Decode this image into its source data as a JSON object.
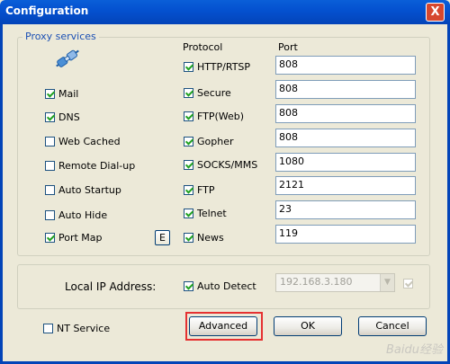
{
  "window": {
    "title": "Configuration",
    "close_label": "X"
  },
  "proxy": {
    "group_label": "Proxy services",
    "protocol_header": "Protocol",
    "port_header": "Port",
    "services": [
      {
        "label": "Mail",
        "checked": true
      },
      {
        "label": "DNS",
        "checked": true
      },
      {
        "label": "Web Cached",
        "checked": false
      },
      {
        "label": "Remote Dial-up",
        "checked": false
      },
      {
        "label": "Auto Startup",
        "checked": false
      },
      {
        "label": "Auto Hide",
        "checked": false
      },
      {
        "label": "Port Map",
        "checked": true
      }
    ],
    "e_button": "E",
    "protocols": [
      {
        "label": "HTTP/RTSP",
        "checked": true,
        "port": "808"
      },
      {
        "label": "Secure",
        "checked": true,
        "port": "808"
      },
      {
        "label": "FTP(Web)",
        "checked": true,
        "port": "808"
      },
      {
        "label": "Gopher",
        "checked": true,
        "port": "808"
      },
      {
        "label": "SOCKS/MMS",
        "checked": true,
        "port": "1080"
      },
      {
        "label": "FTP",
        "checked": true,
        "port": "2121"
      },
      {
        "label": "Telnet",
        "checked": true,
        "port": "23"
      },
      {
        "label": "News",
        "checked": true,
        "port": "119"
      }
    ]
  },
  "local_ip": {
    "label": "Local IP Address:",
    "auto_detect_label": "Auto Detect",
    "auto_detect_checked": true,
    "ip_value": "192.168.3.180",
    "extra_checked": true
  },
  "footer": {
    "nt_service_label": "NT Service",
    "nt_service_checked": false,
    "advanced_label": "Advanced",
    "ok_label": "OK",
    "cancel_label": "Cancel"
  },
  "watermark": "Baidu经验"
}
